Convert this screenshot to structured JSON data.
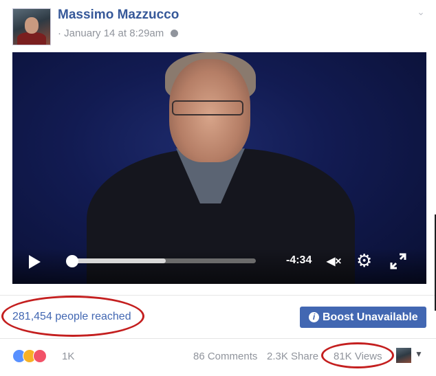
{
  "post": {
    "author": "Massimo Mazzucco",
    "timestamp": "January 14 at 8:29am",
    "meta_prefix": "·"
  },
  "icons": {
    "privacy": "globe-icon",
    "menu": "chevron-down-icon",
    "play": "play-icon",
    "mute": "mute-icon",
    "settings": "gear-icon",
    "fullscreen": "fullscreen-icon",
    "info": "info-icon"
  },
  "video": {
    "time_remaining": "-4:34",
    "progress": 0.52,
    "mute_label": "◀×",
    "gear_glyph": "⚙"
  },
  "insights": {
    "reach_text": "281,454 people reached",
    "boost_label": "Boost Unavailable",
    "boost_info_glyph": "i"
  },
  "stats": {
    "reaction_count": "1K",
    "comments": "86 Comments",
    "shares": "2.3K Share",
    "views": "81K Views",
    "caret": "▼"
  },
  "colors": {
    "link_blue": "#365899",
    "button_blue": "#4267b2",
    "annotation_red": "#c41f1f",
    "muted_grey": "#90949c"
  }
}
